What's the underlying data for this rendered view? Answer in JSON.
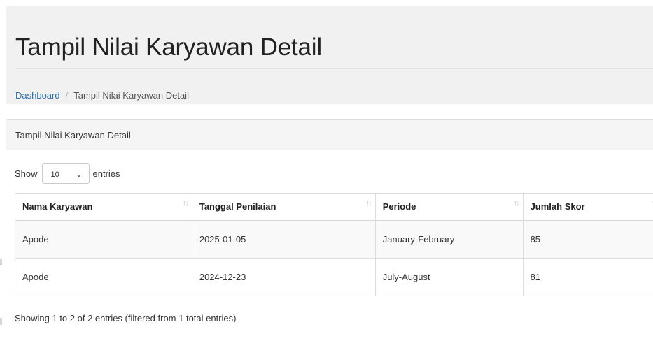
{
  "header": {
    "title": "Tampil Nilai Karyawan Detail",
    "breadcrumb": {
      "home": "Dashboard",
      "separator": "/",
      "current": "Tampil Nilai Karyawan Detail"
    }
  },
  "panel": {
    "heading": "Tampil Nilai Karyawan Detail",
    "length": {
      "show_label": "Show",
      "selected": "10",
      "entries_label": "entries"
    },
    "table": {
      "columns": [
        "Nama Karyawan",
        "Tanggal Penilaian",
        "Periode",
        "Jumlah Skor"
      ],
      "rows": [
        [
          "Apode",
          "2025-01-05",
          "January-February",
          "85"
        ],
        [
          "Apode",
          "2024-12-23",
          "July-August",
          "81"
        ]
      ]
    },
    "info": "Showing 1 to 2 of 2 entries (filtered from 1 total entries)"
  },
  "colors": {
    "link": "#2a6fb3",
    "header_bg": "#f1f1f1",
    "panel_heading_bg": "#f5f5f5"
  },
  "icons": {
    "sort": "sort-arrows-icon",
    "dropdown": "chevron-down-icon"
  }
}
